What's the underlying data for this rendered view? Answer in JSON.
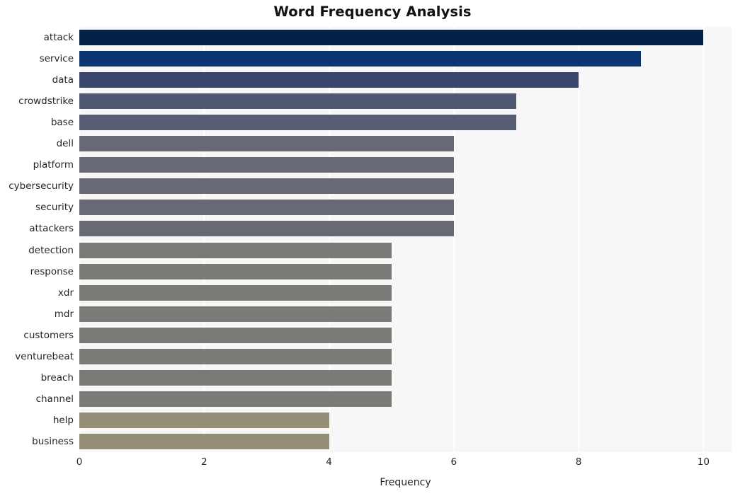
{
  "chart_data": {
    "type": "bar",
    "orientation": "horizontal",
    "title": "Word Frequency Analysis",
    "xlabel": "Frequency",
    "ylabel": "",
    "xlim": [
      0,
      10.45
    ],
    "xticks": [
      0,
      2,
      4,
      6,
      8,
      10
    ],
    "xtick_labels": [
      "0",
      "2",
      "4",
      "6",
      "8",
      "10"
    ],
    "grid": true,
    "grid_axis": "x",
    "grid_color": "#ffffff",
    "plot_background": "#f7f7f8",
    "figure_background": "#ffffff",
    "legend": null,
    "categories": [
      "attack",
      "service",
      "data",
      "crowdstrike",
      "base",
      "dell",
      "platform",
      "cybersecurity",
      "security",
      "attackers",
      "detection",
      "response",
      "xdr",
      "mdr",
      "customers",
      "venturebeat",
      "breach",
      "channel",
      "help",
      "business"
    ],
    "values": [
      10,
      9,
      8,
      7,
      7,
      6,
      6,
      6,
      6,
      6,
      5,
      5,
      5,
      5,
      5,
      5,
      5,
      5,
      4,
      4
    ],
    "bar_colors": [
      "#042147",
      "#0e3573",
      "#39456c",
      "#4f5871",
      "#555d73",
      "#676a74",
      "#676a74",
      "#676a74",
      "#676a74",
      "#676a74",
      "#7b7a77",
      "#7b7a77",
      "#7b7a77",
      "#7b7a77",
      "#7b7a77",
      "#7b7a77",
      "#7b7a77",
      "#7b7a77",
      "#938e75",
      "#938e75"
    ]
  }
}
